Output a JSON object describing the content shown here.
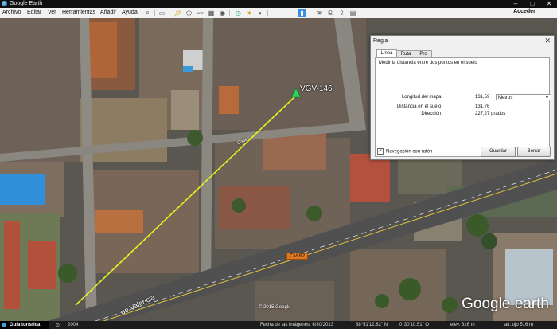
{
  "window": {
    "title": "Google Earth",
    "controls": [
      "–",
      "□",
      "✕"
    ]
  },
  "menu": [
    "Archivo",
    "Editar",
    "Ver",
    "Herramientas",
    "Añadir",
    "Ayuda"
  ],
  "toolbar": {
    "icons": [
      "search-icon",
      "sidebar-icon",
      "placemark-icon",
      "polygon-icon",
      "path-icon",
      "overlay-icon",
      "tour-icon",
      "history-icon",
      "sun-icon",
      "planets-icon",
      "ruler-icon",
      "email-icon",
      "print-icon",
      "share-icon",
      "maps-icon"
    ],
    "signin_label": "Acceder"
  },
  "map": {
    "placemark_label": "VGV-146",
    "road_badge": "CV-62",
    "street_label": "de Valencia",
    "logo": {
      "brand": "Google",
      "product": "earth"
    },
    "copyright": "© 2015 Google"
  },
  "dialog": {
    "title": "Regla",
    "close": "✕",
    "tabs": [
      "Línea",
      "Ruta",
      "Pro"
    ],
    "active_tab": "Línea",
    "description": "Medir la distancia entre dos puntos en el suelo",
    "rows": [
      {
        "label": "Longitud del mapa:",
        "value": "131,59"
      },
      {
        "label": "Distancia en el suelo:",
        "value": "131,76"
      },
      {
        "label": "Dirección:",
        "value": "227,27 grados"
      }
    ],
    "unit": "Metros",
    "nav_label": "Navegación con ratón",
    "nav_checked": true,
    "save_label": "Guardar",
    "clear_label": "Borrar"
  },
  "status": {
    "tour_guide": "Guía turística",
    "year": "2004",
    "imagery_date": "Fecha de las imágenes: 6/30/2013",
    "lat": "38°51'12.62\" N",
    "lon": "0°30'10.51\" O",
    "elev": "elev.  316 m",
    "eye_alt": "alt. ojo  516 m"
  },
  "colors": {
    "measure_line": "#e8f020",
    "placemark": "#2fd35a",
    "road_badge": "#e0781e"
  }
}
